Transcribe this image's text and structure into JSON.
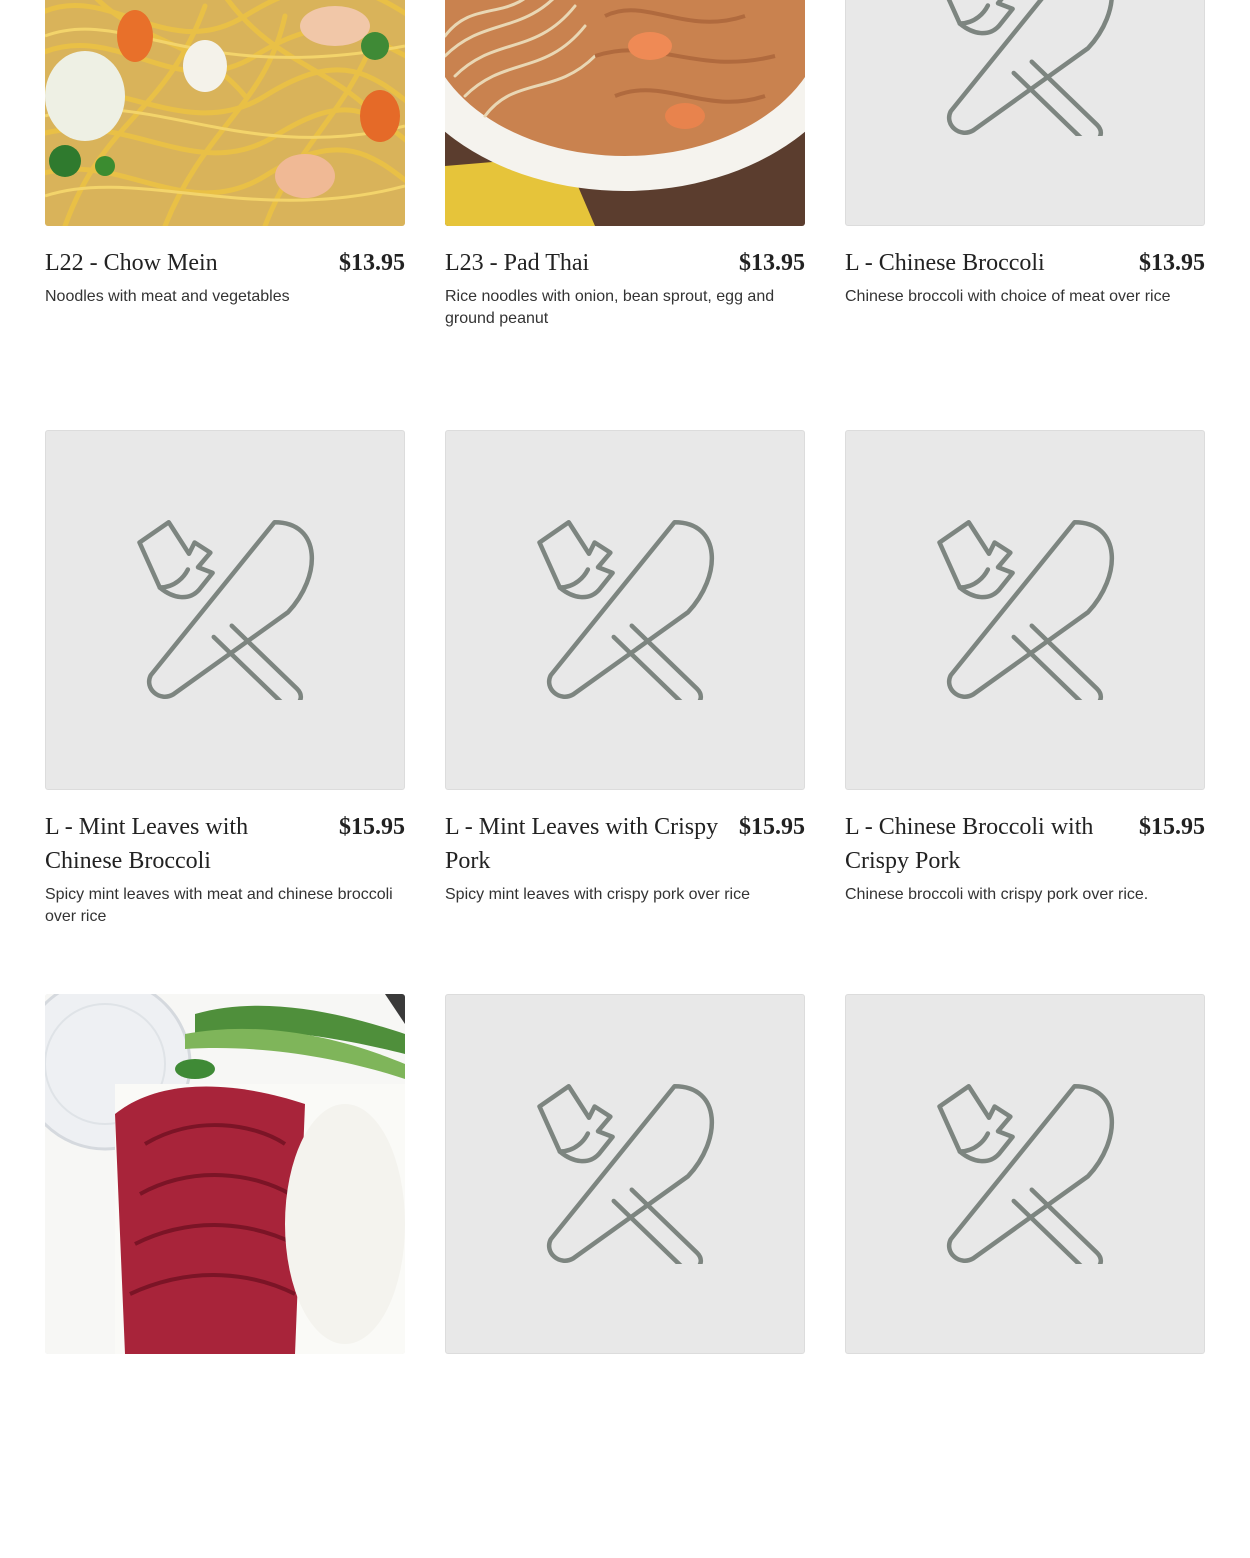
{
  "menu": {
    "items": [
      {
        "name": "L22 - Chow Mein",
        "price": "$13.95",
        "description": "Noodles with meat and vegetables",
        "image": "photo-chow-mein"
      },
      {
        "name": "L23 - Pad Thai",
        "price": "$13.95",
        "description": "Rice noodles with onion, bean sprout, egg and ground peanut",
        "image": "photo-pad-thai"
      },
      {
        "name": "L - Chinese Broccoli",
        "price": "$13.95",
        "description": "Chinese broccoli with choice of meat over rice",
        "image": "fork-knife-icon"
      },
      {
        "name": "L - Mint Leaves with Chinese Broccoli",
        "price": "$15.95",
        "description": "Spicy mint leaves with meat and chinese broccoli over rice",
        "image": "fork-knife-icon"
      },
      {
        "name": "L - Mint Leaves with Crispy Pork",
        "price": "$15.95",
        "description": "Spicy mint leaves with crispy pork over rice",
        "image": "fork-knife-icon"
      },
      {
        "name": "L - Chinese Broccoli with Crispy Pork",
        "price": "$15.95",
        "description": "Chinese broccoli with crispy pork over rice.",
        "image": "fork-knife-icon"
      },
      {
        "name": "",
        "price": "",
        "description": "",
        "image": "photo-bbq-pork-rice"
      },
      {
        "name": "",
        "price": "",
        "description": "",
        "image": "fork-knife-icon"
      },
      {
        "name": "",
        "price": "",
        "description": "",
        "image": "fork-knife-icon"
      }
    ]
  },
  "colors": {
    "placeholder_bg": "#e8e8e8",
    "placeholder_icon": "#7d8580",
    "text": "#222222"
  }
}
